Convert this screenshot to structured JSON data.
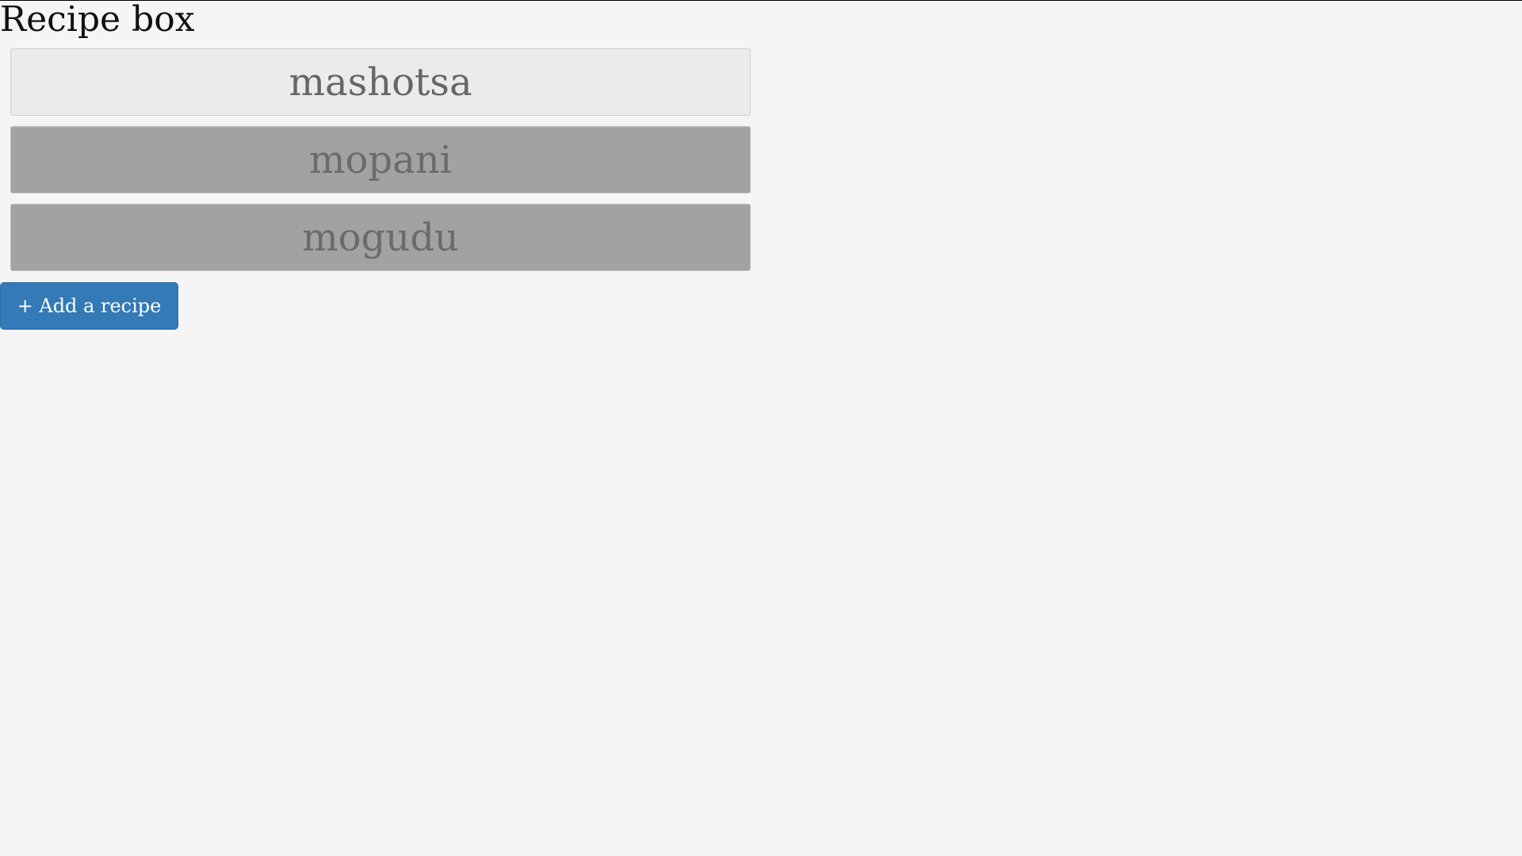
{
  "page": {
    "title": "Recipe box"
  },
  "recipes": [
    {
      "name": "mashotsa",
      "state": "expanded"
    },
    {
      "name": "mopani",
      "state": "collapsed"
    },
    {
      "name": "mogudu",
      "state": "collapsed"
    }
  ],
  "actions": {
    "add_recipe_label": "+ Add a recipe"
  },
  "colors": {
    "background": "#f5f5f5",
    "active_item_bg": "#ebebeb",
    "collapsed_item_bg": "#a2a2a2",
    "item_text": "#6b6b6b",
    "primary_button": "#337ab7"
  }
}
